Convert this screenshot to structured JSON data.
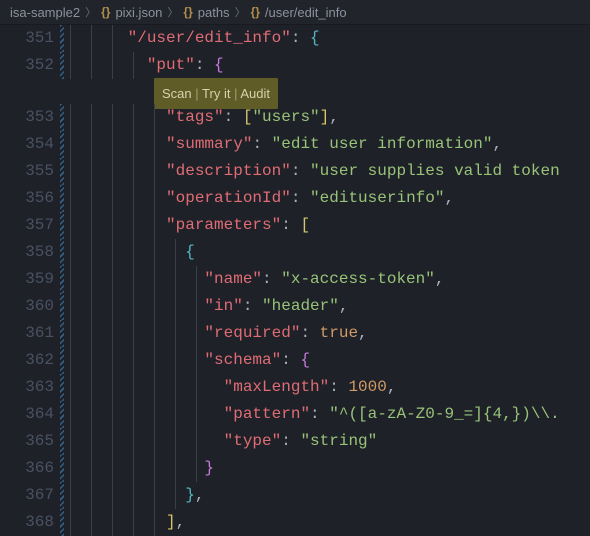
{
  "breadcrumb": {
    "items": [
      "isa-sample2",
      "pixi.json",
      "paths",
      "/user/edit_info"
    ]
  },
  "codelens": {
    "scan": "Scan",
    "tryit": "Try it",
    "audit": "Audit",
    "sep": "|"
  },
  "lines": [
    {
      "num": "351",
      "ig": 3,
      "tokens": [
        {
          "t": "      ",
          "c": "punct"
        },
        {
          "t": "\"/user/edit_info\"",
          "c": "key"
        },
        {
          "t": ": ",
          "c": "punct"
        },
        {
          "t": "{",
          "c": "bracket-b"
        }
      ]
    },
    {
      "num": "352",
      "ig": 4,
      "lens": true,
      "tokens": [
        {
          "t": "        ",
          "c": "punct"
        },
        {
          "t": "\"put\"",
          "c": "key"
        },
        {
          "t": ": ",
          "c": "punct"
        },
        {
          "t": "{",
          "c": "bracket-p"
        }
      ]
    },
    {
      "num": "353",
      "ig": 5,
      "tokens": [
        {
          "t": "          ",
          "c": "punct"
        },
        {
          "t": "\"tags\"",
          "c": "key"
        },
        {
          "t": ": ",
          "c": "punct"
        },
        {
          "t": "[",
          "c": "bracket-y"
        },
        {
          "t": "\"users\"",
          "c": "string"
        },
        {
          "t": "]",
          "c": "bracket-y"
        },
        {
          "t": ",",
          "c": "punct"
        }
      ]
    },
    {
      "num": "354",
      "ig": 5,
      "tokens": [
        {
          "t": "          ",
          "c": "punct"
        },
        {
          "t": "\"summary\"",
          "c": "key"
        },
        {
          "t": ": ",
          "c": "punct"
        },
        {
          "t": "\"edit user information\"",
          "c": "string"
        },
        {
          "t": ",",
          "c": "punct"
        }
      ]
    },
    {
      "num": "355",
      "ig": 5,
      "tokens": [
        {
          "t": "          ",
          "c": "punct"
        },
        {
          "t": "\"description\"",
          "c": "key"
        },
        {
          "t": ": ",
          "c": "punct"
        },
        {
          "t": "\"user supplies valid token",
          "c": "string"
        }
      ]
    },
    {
      "num": "356",
      "ig": 5,
      "tokens": [
        {
          "t": "          ",
          "c": "punct"
        },
        {
          "t": "\"operationId\"",
          "c": "key"
        },
        {
          "t": ": ",
          "c": "punct"
        },
        {
          "t": "\"edituserinfo\"",
          "c": "string"
        },
        {
          "t": ",",
          "c": "punct"
        }
      ]
    },
    {
      "num": "357",
      "ig": 5,
      "tokens": [
        {
          "t": "          ",
          "c": "punct"
        },
        {
          "t": "\"parameters\"",
          "c": "key"
        },
        {
          "t": ": ",
          "c": "punct"
        },
        {
          "t": "[",
          "c": "bracket-y"
        }
      ]
    },
    {
      "num": "358",
      "ig": 6,
      "tokens": [
        {
          "t": "            ",
          "c": "punct"
        },
        {
          "t": "{",
          "c": "bracket-b"
        }
      ]
    },
    {
      "num": "359",
      "ig": 7,
      "tokens": [
        {
          "t": "              ",
          "c": "punct"
        },
        {
          "t": "\"name\"",
          "c": "key"
        },
        {
          "t": ": ",
          "c": "punct"
        },
        {
          "t": "\"x-access-token\"",
          "c": "string"
        },
        {
          "t": ",",
          "c": "punct"
        }
      ]
    },
    {
      "num": "360",
      "ig": 7,
      "tokens": [
        {
          "t": "              ",
          "c": "punct"
        },
        {
          "t": "\"in\"",
          "c": "key"
        },
        {
          "t": ": ",
          "c": "punct"
        },
        {
          "t": "\"header\"",
          "c": "string"
        },
        {
          "t": ",",
          "c": "punct"
        }
      ]
    },
    {
      "num": "361",
      "ig": 7,
      "tokens": [
        {
          "t": "              ",
          "c": "punct"
        },
        {
          "t": "\"required\"",
          "c": "key"
        },
        {
          "t": ": ",
          "c": "punct"
        },
        {
          "t": "true",
          "c": "bool"
        },
        {
          "t": ",",
          "c": "punct"
        }
      ]
    },
    {
      "num": "362",
      "ig": 7,
      "tokens": [
        {
          "t": "              ",
          "c": "punct"
        },
        {
          "t": "\"schema\"",
          "c": "key"
        },
        {
          "t": ": ",
          "c": "punct"
        },
        {
          "t": "{",
          "c": "bracket-p"
        }
      ]
    },
    {
      "num": "363",
      "ig": 7,
      "tokens": [
        {
          "t": "                ",
          "c": "punct"
        },
        {
          "t": "\"maxLength\"",
          "c": "key"
        },
        {
          "t": ": ",
          "c": "punct"
        },
        {
          "t": "1000",
          "c": "number"
        },
        {
          "t": ",",
          "c": "punct"
        }
      ]
    },
    {
      "num": "364",
      "ig": 7,
      "tokens": [
        {
          "t": "                ",
          "c": "punct"
        },
        {
          "t": "\"pattern\"",
          "c": "key"
        },
        {
          "t": ": ",
          "c": "punct"
        },
        {
          "t": "\"^([a-zA-Z0-9_=]{4,})\\\\.",
          "c": "string"
        }
      ]
    },
    {
      "num": "365",
      "ig": 7,
      "tokens": [
        {
          "t": "                ",
          "c": "punct"
        },
        {
          "t": "\"type\"",
          "c": "key"
        },
        {
          "t": ": ",
          "c": "punct"
        },
        {
          "t": "\"string\"",
          "c": "string"
        }
      ]
    },
    {
      "num": "366",
      "ig": 7,
      "tokens": [
        {
          "t": "              ",
          "c": "punct"
        },
        {
          "t": "}",
          "c": "bracket-p"
        }
      ]
    },
    {
      "num": "367",
      "ig": 6,
      "tokens": [
        {
          "t": "            ",
          "c": "punct"
        },
        {
          "t": "}",
          "c": "bracket-b"
        },
        {
          "t": ",",
          "c": "punct"
        }
      ]
    },
    {
      "num": "368",
      "ig": 5,
      "tokens": [
        {
          "t": "          ",
          "c": "punct"
        },
        {
          "t": "]",
          "c": "bracket-y"
        },
        {
          "t": ",",
          "c": "punct"
        }
      ]
    }
  ]
}
